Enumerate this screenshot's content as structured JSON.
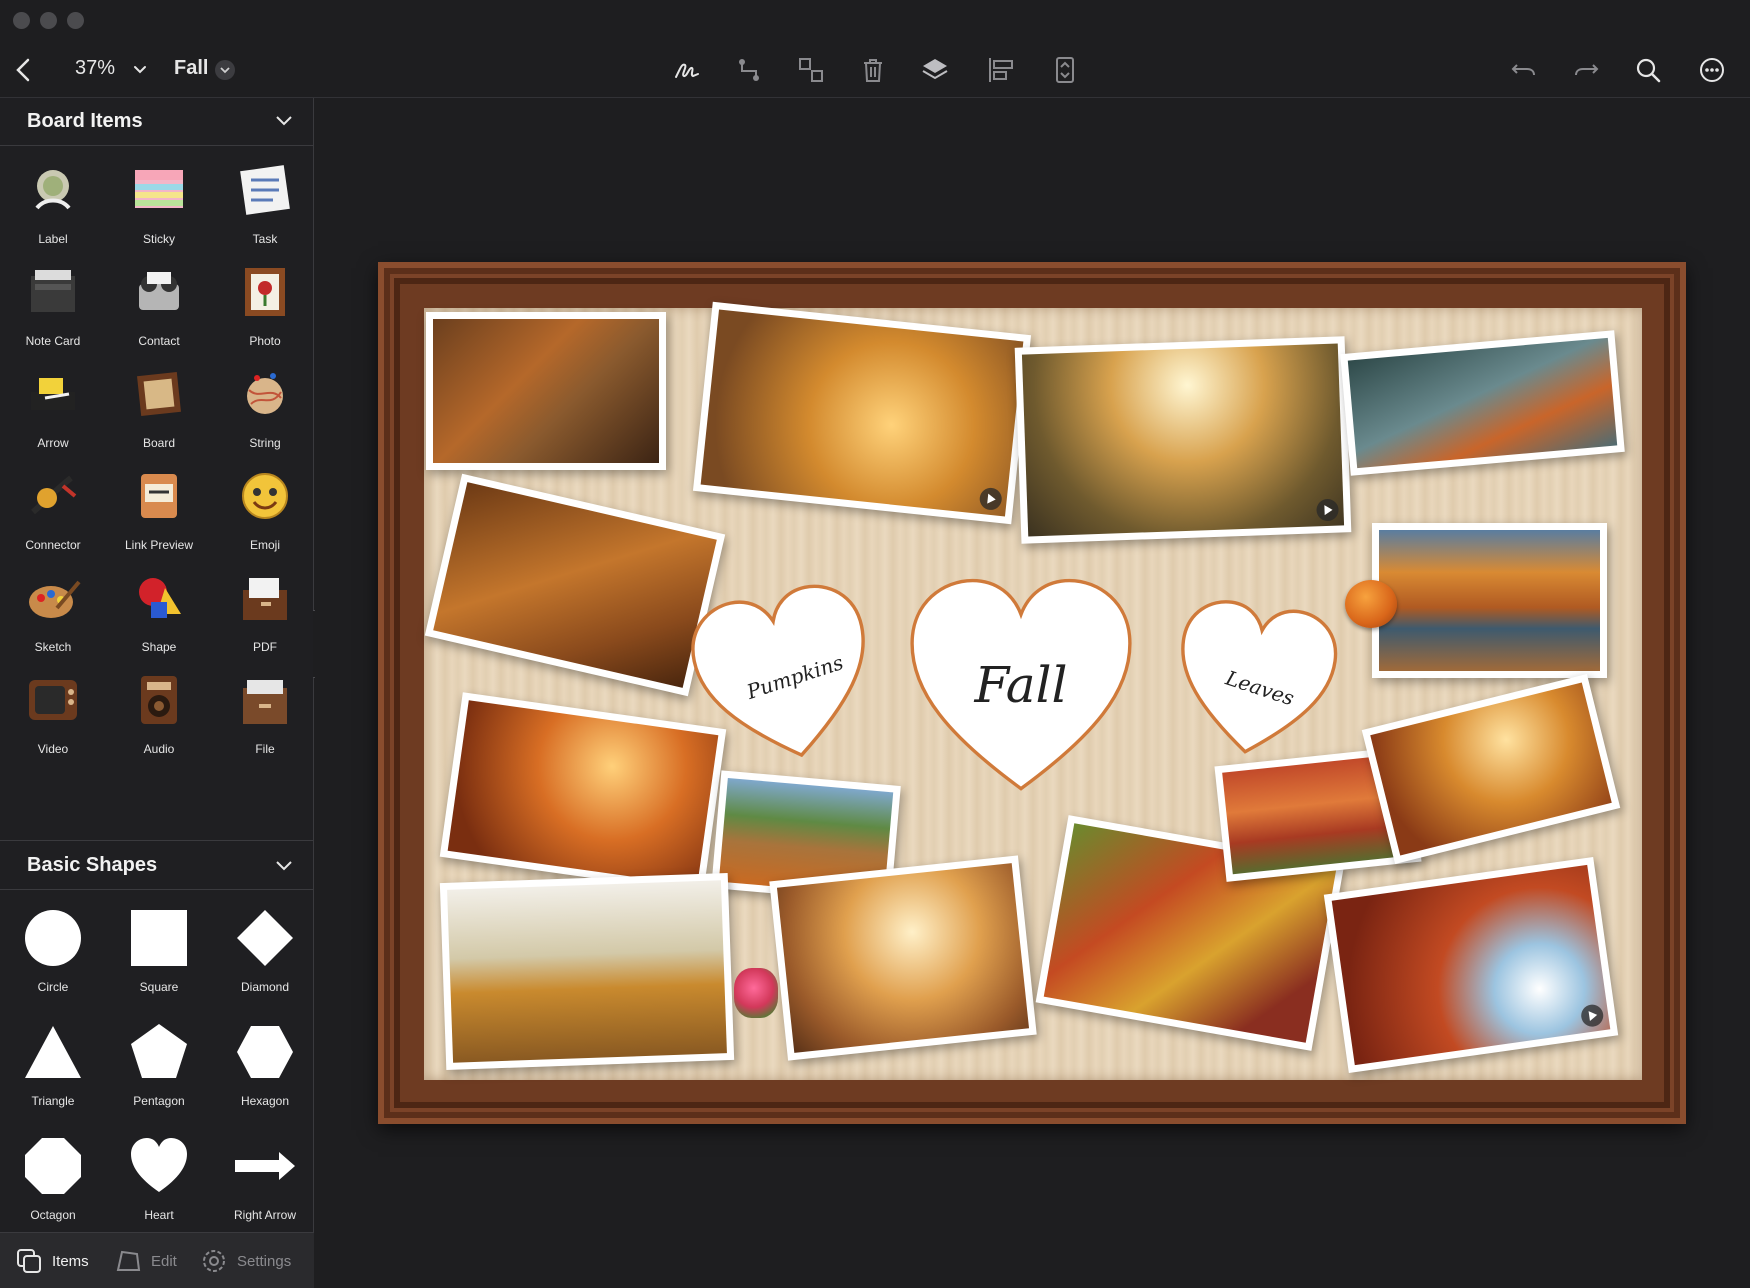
{
  "toolbar": {
    "zoom": "37%",
    "board_title": "Fall"
  },
  "sidebar": {
    "board_items_title": "Board Items",
    "board_items": [
      {
        "label": "Label",
        "icon": "label-icon"
      },
      {
        "label": "Sticky",
        "icon": "sticky-icon"
      },
      {
        "label": "Task",
        "icon": "task-icon"
      },
      {
        "label": "Note Card",
        "icon": "note-card-icon"
      },
      {
        "label": "Contact",
        "icon": "contact-icon"
      },
      {
        "label": "Photo",
        "icon": "photo-icon"
      },
      {
        "label": "Arrow",
        "icon": "arrow-icon"
      },
      {
        "label": "Board",
        "icon": "board-icon"
      },
      {
        "label": "String",
        "icon": "string-icon"
      },
      {
        "label": "Connector",
        "icon": "connector-icon"
      },
      {
        "label": "Link Preview",
        "icon": "link-preview-icon"
      },
      {
        "label": "Emoji",
        "icon": "emoji-icon"
      },
      {
        "label": "Sketch",
        "icon": "sketch-icon"
      },
      {
        "label": "Shape",
        "icon": "shape-icon"
      },
      {
        "label": "PDF",
        "icon": "pdf-icon"
      },
      {
        "label": "Video",
        "icon": "video-icon"
      },
      {
        "label": "Audio",
        "icon": "audio-icon"
      },
      {
        "label": "File",
        "icon": "file-icon"
      }
    ],
    "basic_shapes_title": "Basic Shapes",
    "basic_shapes": [
      {
        "label": "Circle"
      },
      {
        "label": "Square"
      },
      {
        "label": "Diamond"
      },
      {
        "label": "Triangle"
      },
      {
        "label": "Pentagon"
      },
      {
        "label": "Hexagon"
      },
      {
        "label": "Octagon"
      },
      {
        "label": "Heart"
      },
      {
        "label": "Right Arrow"
      }
    ],
    "tabs": {
      "items": "Items",
      "edit": "Edit",
      "settings": "Settings"
    }
  },
  "board": {
    "hearts": [
      {
        "text": "Pumpkins"
      },
      {
        "text": "Fall"
      },
      {
        "text": "Leaves"
      }
    ]
  },
  "colors": {
    "frame": "#6e3b22",
    "heart_outline": "#d07a3a",
    "background": "#1e1e20"
  }
}
